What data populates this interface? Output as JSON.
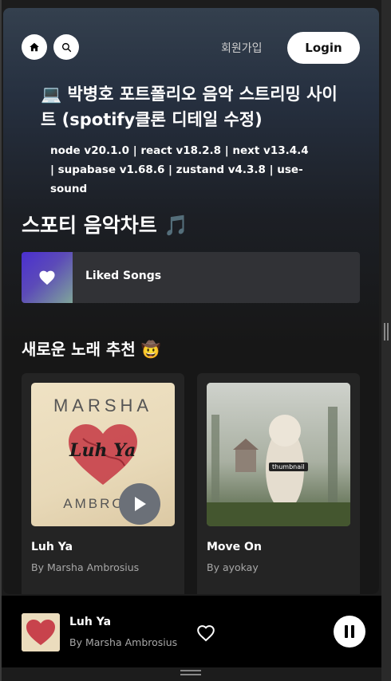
{
  "nav": {
    "signup_label": "회원가입",
    "login_label": "Login"
  },
  "intro": {
    "title": "💻 박병호 포트폴리오 음악 스트리밍 사이트 (spotify클론 디테일 수정)",
    "versions": "node v20.1.0 | react v18.2.8 | next v13.4.4 | supabase v1.68.6 | zustand v4.3.8 | use-sound"
  },
  "chart_section": {
    "heading": "스포티 음악차트 🎵",
    "liked_songs_label": "Liked Songs"
  },
  "new_section": {
    "heading": "새로운 노래 추천 🤠",
    "songs": [
      {
        "title": "Luh Ya",
        "artist": "By Marsha Ambrosius",
        "art_top": "MARSHA",
        "art_center": "Luh Ya",
        "art_bottom": "AMBROSI"
      },
      {
        "title": "Move On",
        "artist": "By ayokay",
        "art_tag": "thumbnail"
      }
    ]
  },
  "player": {
    "title": "Luh Ya",
    "artist": "By Marsha Ambrosius"
  },
  "colors": {
    "header_top": "#34404e",
    "background": "#171717",
    "card": "#242424",
    "liked_gradient_start": "#4a2fd0"
  }
}
